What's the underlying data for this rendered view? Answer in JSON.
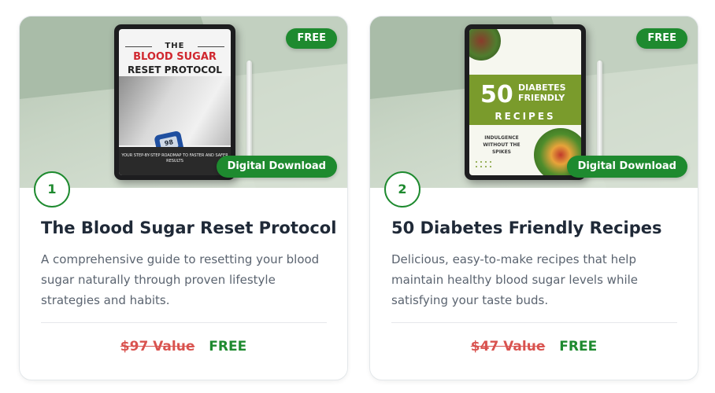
{
  "cards": [
    {
      "badge": "FREE",
      "download_label": "Digital Download",
      "number": "1",
      "title": "The Blood Sugar Reset Protocol",
      "description": "A comprehensive guide to resetting your blood sugar naturally through proven lifestyle strategies and habits.",
      "old_price": "$97 Value",
      "price": "FREE",
      "cover": {
        "kicker": "THE",
        "title": "BLOOD SUGAR",
        "subtitle": "RESET PROTOCOL",
        "meter_reading": "98",
        "caption": "YOUR STEP-BY-STEP ROADMAP TO FASTER AND SAFER RESULTS"
      }
    },
    {
      "badge": "FREE",
      "download_label": "Digital Download",
      "number": "2",
      "title": "50 Diabetes Friendly Recipes",
      "description": "Delicious, easy-to-make recipes that help maintain healthy blood sugar levels while satisfying your taste buds.",
      "old_price": "$47 Value",
      "price": "FREE",
      "cover": {
        "big_number": "50",
        "title_line1": "DIABETES",
        "title_line2": "FRIENDLY",
        "title_line3": "RECIPES",
        "tagline": "INDULGENCE WITHOUT THE SPIKES"
      }
    }
  ],
  "colors": {
    "accent_green": "#1e8a2f",
    "strike_red": "#d9534f",
    "cover_red": "#d0272f",
    "cover_olive": "#7a9b2c"
  }
}
